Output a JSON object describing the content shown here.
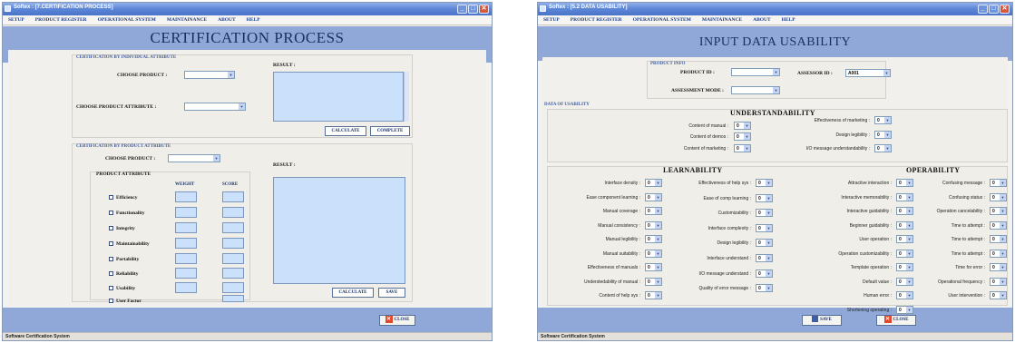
{
  "w1": {
    "title": "Softex : [7.CERTIFICATION PROCESS]",
    "menu": [
      "SETUP",
      "PRODUCT REGISTER",
      "OPERATIONAL SYSTEM",
      "MAINTAINANCE",
      "ABOUT",
      "HELP"
    ],
    "heading": "CERTIFICATION PROCESS",
    "individual": {
      "section": "CERTIFICATION BY INDIVIDUAL ATTRIBUTE",
      "choose_product": "CHOOSE PRODUCT :",
      "choose_attr": "CHOOSE PRODUCT ATTRIBUTE :",
      "result": "RESULT :",
      "calculate": "CALCULATE",
      "complete": "COMPLETE"
    },
    "product": {
      "section": "CERTIFICATION BY PRODUCT ATTRIBUTE",
      "choose_product": "CHOOSE PRODUCT :",
      "attr_title": "PRODUCT ATTRIBUTE",
      "weight": "WEIGHT",
      "score": "SCORE",
      "result": "RESULT :",
      "calculate": "CALCULATE",
      "save": "SAVE",
      "attributes": [
        "Efficiency",
        "Functionality",
        "Integrity",
        "Maintainability",
        "Portability",
        "Reliability",
        "Usability",
        "User Factor"
      ]
    },
    "close": "CLOSE",
    "status": "Software Certification System"
  },
  "w2": {
    "title": "Softex : [5.2 DATA USABILITY]",
    "menu": [
      "SETUP",
      "PRODUCT REGISTER",
      "OPERATIONAL SYSTEM",
      "MAINTAINANCE",
      "ABOUT",
      "HELP"
    ],
    "heading": "INPUT DATA USABILITY",
    "product_info": "PRODUCT INFO",
    "product_id": "PRODUCT ID :",
    "assessor_id": "ASSESSOR ID :",
    "assessor_val": "A001",
    "assessment_mode": "ASSESSMENT MODE :",
    "data_of_usability": "DATA OF USABILITY",
    "understandability": "UNDERSTANDABILITY",
    "und_left": [
      "Content of manual :",
      "Content of demos :",
      "Content of marketing :"
    ],
    "und_right": [
      "Effectiveness of marketing :",
      "Design legibility :",
      "I/O message understandability :"
    ],
    "learnability": "LEARNABILITY",
    "operability": "OPERABILITY",
    "col1": [
      "Interface density :",
      "Ease component learning :",
      "Manual coverage :",
      "Manual consistency :",
      "Manual legibility :",
      "Manual suitability :",
      "Effectiveness of manuals :",
      "Understedability of manual :",
      "Content of help sys :"
    ],
    "col2": [
      "Effectiveness of help sys :",
      "Ease of comp learning :",
      "Customizability :",
      "Interface complexity :",
      "Design legibility :",
      "Interface understand :",
      "I/O message understand :",
      "Quality of error message :"
    ],
    "col3": [
      "Attractive interaction :",
      "Interactive memorability :",
      "Interactive guidability :",
      "Beginner guidability :",
      "User operation :",
      "Operation customizability :",
      "Template operation :",
      "Default value :",
      "Human error :",
      "Shortening operating :"
    ],
    "col4": [
      "Confusing message :",
      "Confusing status :",
      "Operation cancelability :",
      "Time to attempt :",
      "Time to attempt :",
      "Time to attempt :",
      "Time for error :",
      "Operational frequency :",
      "User intervention :"
    ],
    "zero": "0",
    "save": "SAVE",
    "close": "CLOSE",
    "status": "Software Certification System"
  }
}
